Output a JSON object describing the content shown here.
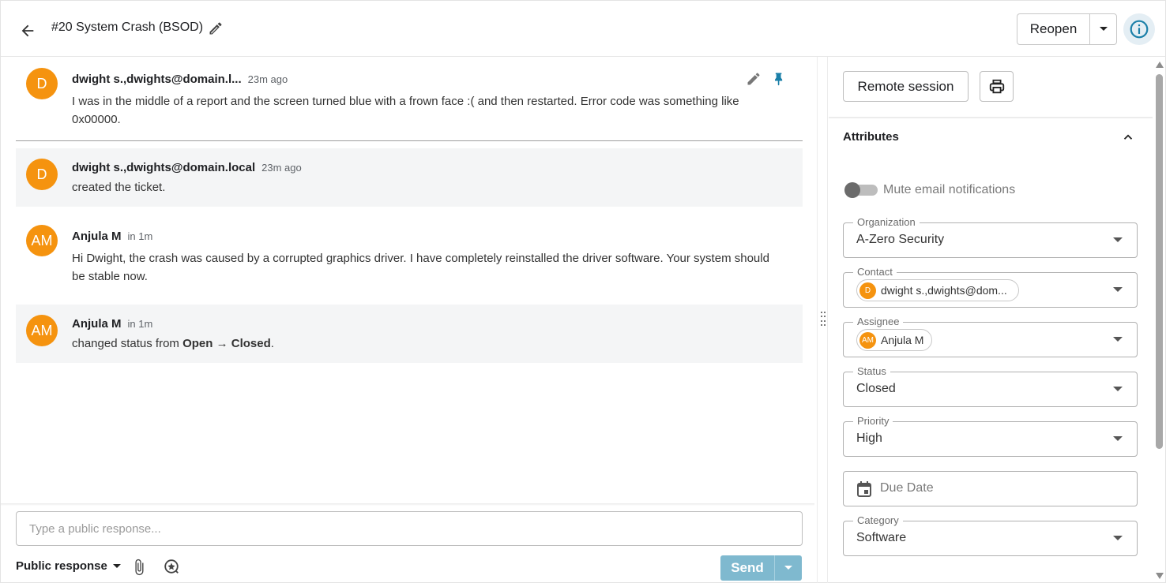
{
  "header": {
    "title": "#20 System Crash (BSOD)",
    "reopen_label": "Reopen"
  },
  "messages": [
    {
      "avatar": "D",
      "author": "dwight s.,dwights@domain.l...",
      "time": "23m ago",
      "body": "I was in the middle of a report and the screen turned blue with a frown face :( and then restarted. Error code was something like 0x00000."
    },
    {
      "avatar": "D",
      "author": "dwight s.,dwights@domain.local",
      "time": "23m ago",
      "body": "created the ticket."
    },
    {
      "avatar": "AM",
      "author": "Anjula M",
      "time": "in 1m",
      "body": "Hi Dwight, the crash was caused by a corrupted graphics driver. I have completely reinstalled the driver software. Your system should be stable now."
    },
    {
      "avatar": "AM",
      "author": "Anjula M",
      "time": "in 1m",
      "body_prefix": "changed status from ",
      "from": "Open",
      "arrow": " → ",
      "to": "Closed",
      "suffix": "."
    }
  ],
  "composer": {
    "placeholder": "Type a public response...",
    "response_type": "Public response",
    "send_label": "Send"
  },
  "side": {
    "remote_session": "Remote session",
    "attributes_title": "Attributes",
    "mute_label": "Mute email notifications",
    "mute_enabled": false,
    "fields": {
      "organization": {
        "label": "Organization",
        "value": "A-Zero Security"
      },
      "contact": {
        "label": "Contact",
        "avatar": "D",
        "value": "dwight s.,dwights@dom..."
      },
      "assignee": {
        "label": "Assignee",
        "avatar": "AM",
        "value": "Anjula M"
      },
      "status": {
        "label": "Status",
        "value": "Closed"
      },
      "priority": {
        "label": "Priority",
        "value": "High"
      },
      "due_date": {
        "placeholder": "Due Date"
      },
      "category": {
        "label": "Category",
        "value": "Software"
      }
    }
  },
  "colors": {
    "avatar": "#f5930f",
    "accent": "#1a7fa8",
    "send_disabled": "#7fb9cf",
    "pin": "#1a7fa8"
  }
}
